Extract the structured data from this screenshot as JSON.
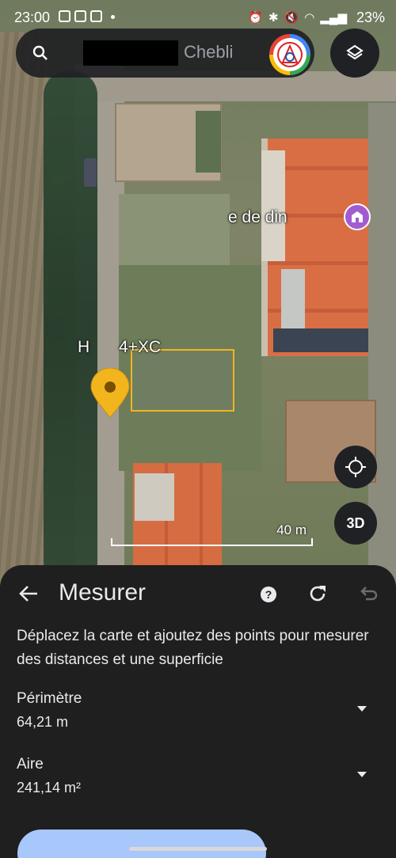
{
  "status_bar": {
    "time": "23:00",
    "battery": "23%"
  },
  "search": {
    "query_visible": "Chebli"
  },
  "map": {
    "partial_label": "e de din",
    "plus_code": "4+XC",
    "plus_code_prefix": "H",
    "scale_label": "40 m",
    "fab_3d_label": "3D"
  },
  "sheet": {
    "title": "Mesurer",
    "help_glyph": "?",
    "description": "Déplacez la carte et ajoutez des points pour mesurer des distances et une superficie",
    "perimeter_label": "Périmètre",
    "perimeter_value": "64,21 m",
    "area_label": "Aire",
    "area_value": "241,14 m²"
  },
  "colors": {
    "accent": "#f2b51e",
    "sheet_bg": "#1f1f1f",
    "button": "#a8c7fa"
  }
}
